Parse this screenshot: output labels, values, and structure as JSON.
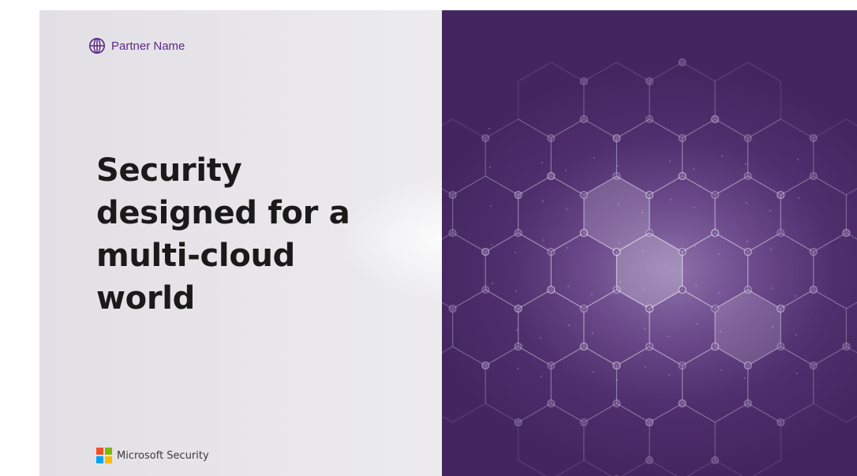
{
  "slide": {
    "partner_name": "Partner Name",
    "headline": "Security\ndesigned for a\nmulti-cloud\nworld",
    "brand_label": "Microsoft Security"
  },
  "icons": {
    "partner": "globe-icon",
    "brand": "microsoft-logo-icon"
  },
  "colors": {
    "accent_purple": "#5b2a86",
    "panel_purple": "#4f2f6d",
    "logo_red": "#f25022",
    "logo_green": "#7fba00",
    "logo_blue": "#00a4ef",
    "logo_yellow": "#ffb900"
  }
}
